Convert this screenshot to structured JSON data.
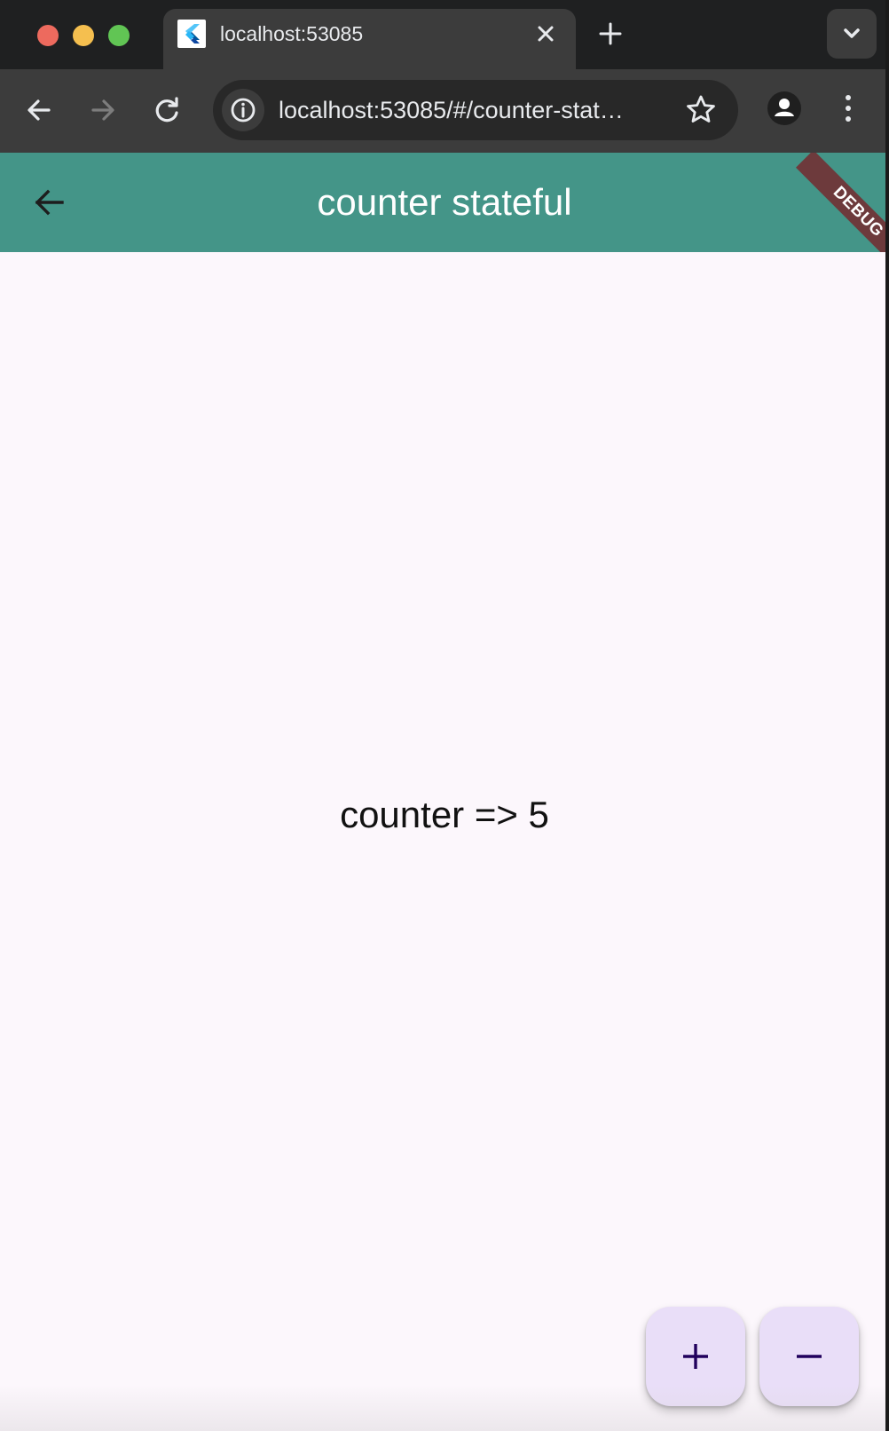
{
  "browser": {
    "tab_title": "localhost:53085",
    "url": "localhost:53085/#/counter-stat…",
    "icons": {
      "close": "close-icon",
      "new_tab": "plus-icon",
      "tab_search": "chevron-down-icon",
      "back": "arrow-left-icon",
      "forward": "arrow-right-icon",
      "reload": "reload-icon",
      "site_info": "info-icon",
      "bookmark": "star-icon",
      "profile": "profile-icon",
      "menu": "kebab-menu-icon"
    }
  },
  "app": {
    "title": "counter stateful",
    "debug_banner": "DEBUG",
    "counter_text": "counter => 5",
    "colors": {
      "app_bar": "#449588",
      "background": "#fcf7fc",
      "fab": "#e9def8",
      "fab_icon": "#21005d"
    },
    "fabs": [
      {
        "label": "+",
        "icon": "plus-icon"
      },
      {
        "label": "−",
        "icon": "minus-icon"
      }
    ]
  }
}
